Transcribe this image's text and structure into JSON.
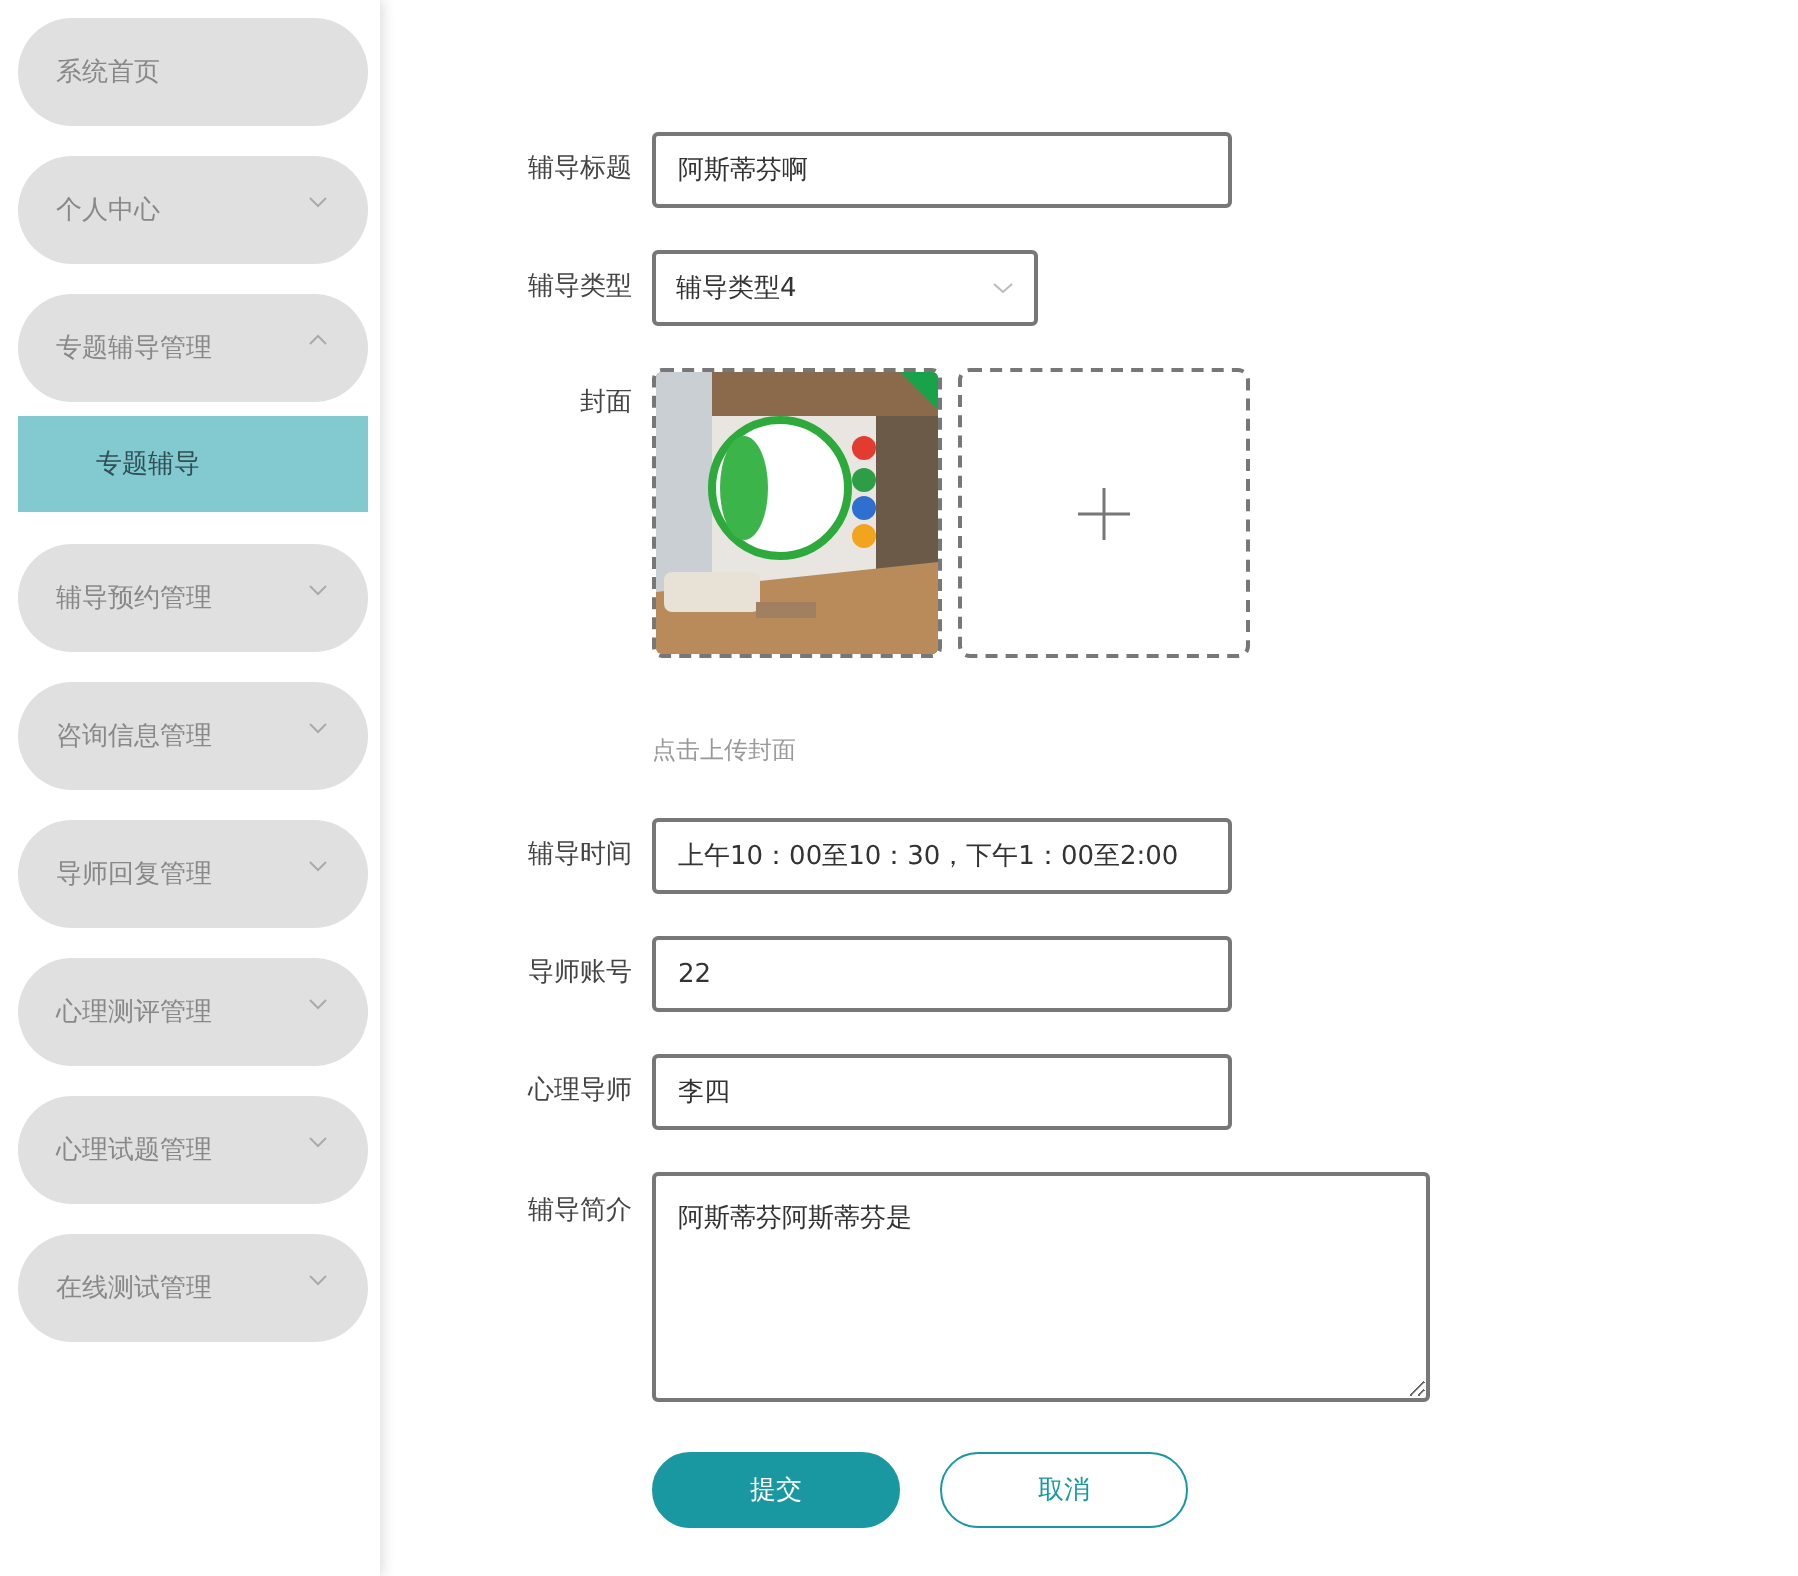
{
  "sidebar": {
    "items": [
      {
        "label": "系统首页",
        "kind": "link"
      },
      {
        "label": "个人中心",
        "kind": "group",
        "expanded": false
      },
      {
        "label": "专题辅导管理",
        "kind": "group",
        "expanded": true,
        "children": [
          {
            "label": "专题辅导",
            "selected": true
          }
        ]
      },
      {
        "label": "辅导预约管理",
        "kind": "group",
        "expanded": false
      },
      {
        "label": "咨询信息管理",
        "kind": "group",
        "expanded": false
      },
      {
        "label": "导师回复管理",
        "kind": "group",
        "expanded": false
      },
      {
        "label": "心理测评管理",
        "kind": "group",
        "expanded": false
      },
      {
        "label": "心理试题管理",
        "kind": "group",
        "expanded": false
      },
      {
        "label": "在线测试管理",
        "kind": "group",
        "expanded": false
      }
    ]
  },
  "form": {
    "fields": [
      {
        "kind": "text",
        "label": "辅导标题",
        "value": "阿斯蒂芬啊"
      },
      {
        "kind": "select",
        "label": "辅导类型",
        "value": "辅导类型4"
      },
      {
        "label": "封面",
        "hint": "点击上传封面"
      },
      {
        "kind": "text",
        "label": "辅导时间",
        "value": "上午10：00至10：30，下午1：00至2:00"
      },
      {
        "kind": "text",
        "label": "导师账号",
        "value": "22"
      },
      {
        "kind": "text",
        "label": "心理导师",
        "value": "李四"
      },
      {
        "kind": "textarea",
        "label": "辅导简介",
        "value": "阿斯蒂芬阿斯蒂芬是"
      }
    ],
    "buttons": [
      {
        "label": "提交",
        "kind": "primary"
      },
      {
        "label": "取消",
        "kind": "secondary"
      }
    ]
  }
}
